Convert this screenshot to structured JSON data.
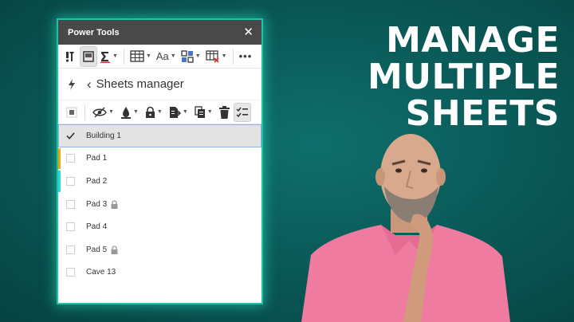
{
  "panel": {
    "title": "Power Tools",
    "close_glyph": "✕"
  },
  "toolbar": {
    "items": [
      "tools-icon",
      "sheets-icon",
      "sum-icon",
      "table-icon",
      "text-format-icon",
      "grid-icon",
      "table-remove-icon",
      "more-icon"
    ],
    "text_format_label": "Aa",
    "more_label": "•••"
  },
  "nav": {
    "back_glyph": "‹",
    "title": "Sheets manager"
  },
  "actions": [
    "select-all-icon",
    "hide-icon",
    "fill-color-icon",
    "lock-icon",
    "move-icon",
    "copy-icon",
    "delete-icon",
    "checklist-icon"
  ],
  "sheets": [
    {
      "name": "Building 1",
      "checked": true,
      "selected": true,
      "tab_color": "",
      "locked": false
    },
    {
      "name": "Pad 1",
      "checked": false,
      "selected": false,
      "tab_color": "#f4a300",
      "locked": false
    },
    {
      "name": "Pad 2",
      "checked": false,
      "selected": false,
      "tab_color": "#2ad6df",
      "locked": false
    },
    {
      "name": "Pad 3",
      "checked": false,
      "selected": false,
      "tab_color": "",
      "locked": true
    },
    {
      "name": "Pad 4",
      "checked": false,
      "selected": false,
      "tab_color": "",
      "locked": false
    },
    {
      "name": "Pad 5",
      "checked": false,
      "selected": false,
      "tab_color": "",
      "locked": true
    },
    {
      "name": "Cave 13",
      "checked": false,
      "selected": false,
      "tab_color": "",
      "locked": false
    }
  ],
  "headline": {
    "line1": "MANAGE",
    "line2": "MULTIPLE",
    "line3": "SHEETS"
  },
  "colors": {
    "background": "#0a5b59",
    "panel_header": "#494949",
    "glow": "#1cc3a6",
    "selected_row": "#e3e3e3",
    "shirt": "#f07ba0"
  }
}
